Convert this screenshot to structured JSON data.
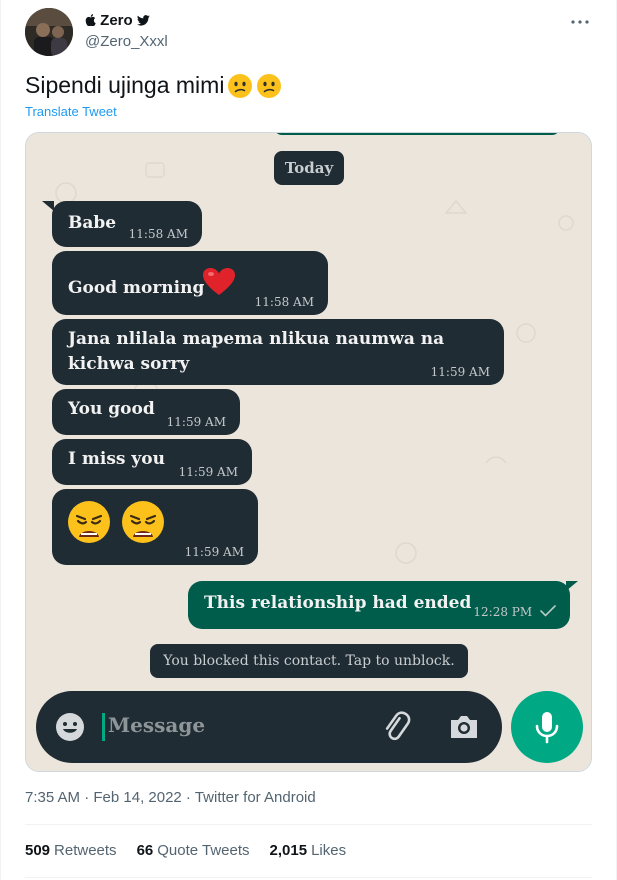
{
  "author": {
    "name": "Zero",
    "handle": "@Zero_Xxxl"
  },
  "tweet": {
    "text": "Sipendi ujinga mimi",
    "translate_label": "Translate Tweet",
    "timestamp": "7:35 AM · Feb 14, 2022 · Twitter for Android"
  },
  "stats": {
    "retweets_count": "509",
    "retweets_label": "Retweets",
    "quotes_count": "66",
    "quotes_label": "Quote Tweets",
    "likes_count": "2,015",
    "likes_label": "Likes"
  },
  "chat": {
    "date_label": "Today",
    "messages": [
      {
        "text": "Babe",
        "time": "11:58 AM",
        "direction": "incoming"
      },
      {
        "text": "Good morning",
        "emoji": "red-heart",
        "time": "11:58 AM",
        "direction": "incoming"
      },
      {
        "line1": "Jana nlilala mapema nlikua naumwa na",
        "line2": "kichwa sorry",
        "time": "11:59 AM",
        "direction": "incoming"
      },
      {
        "text": "You good",
        "time": "11:59 AM",
        "direction": "incoming"
      },
      {
        "text": "I miss you",
        "time": "11:59 AM",
        "direction": "incoming"
      },
      {
        "emoji": "weary-face-x2",
        "time": "11:59 AM",
        "direction": "incoming"
      },
      {
        "text": "This relationship had ended",
        "time": "12:28 PM",
        "direction": "outgoing",
        "status": "sent-check"
      }
    ],
    "blocked_notice": "You blocked this contact. Tap to unblock.",
    "composer_placeholder": "Message"
  },
  "colors": {
    "incoming_bubble": "#202c33",
    "outgoing_bubble": "#005c4b",
    "wa_green": "#00a884",
    "chat_background": "#ece5dc",
    "twitter_blue": "#1d9bf0"
  },
  "icons": [
    "apple-icon",
    "twitter-bird-icon",
    "more-icon",
    "confused-face-icon",
    "heart-icon",
    "weary-face-icon",
    "check-icon",
    "emoji-icon",
    "paperclip-icon",
    "camera-icon",
    "mic-icon"
  ]
}
